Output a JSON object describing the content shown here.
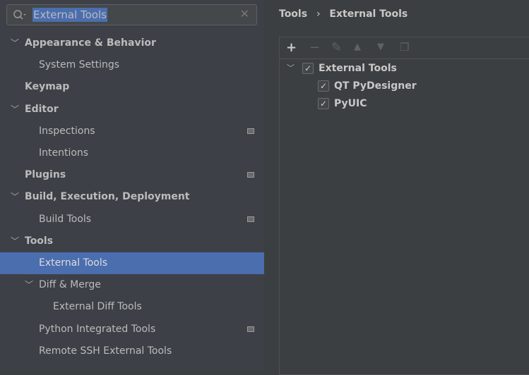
{
  "search": {
    "value": "External Tools",
    "icon": "search-icon"
  },
  "sidebar": {
    "items": [
      {
        "label": "Appearance & Behavior",
        "level": 0,
        "bold": true,
        "expanded": true
      },
      {
        "label": "System Settings",
        "level": 1
      },
      {
        "label": "Keymap",
        "level": 0,
        "bold": true
      },
      {
        "label": "Editor",
        "level": 0,
        "bold": true,
        "expanded": true
      },
      {
        "label": "Inspections",
        "level": 1,
        "project": true
      },
      {
        "label": "Intentions",
        "level": 1
      },
      {
        "label": "Plugins",
        "level": 0,
        "bold": true,
        "project": true
      },
      {
        "label": "Build, Execution, Deployment",
        "level": 0,
        "bold": true,
        "expanded": true
      },
      {
        "label": "Build Tools",
        "level": 1,
        "project": true
      },
      {
        "label": "Tools",
        "level": 0,
        "bold": true,
        "expanded": true
      },
      {
        "label": "External Tools",
        "level": 1,
        "selected": true
      },
      {
        "label": "Diff & Merge",
        "level": 1,
        "expanded": true
      },
      {
        "label": "External Diff Tools",
        "level": 2
      },
      {
        "label": "Python Integrated Tools",
        "level": 1,
        "project": true
      },
      {
        "label": "Remote SSH External Tools",
        "level": 1
      }
    ]
  },
  "breadcrumb": {
    "parent": "Tools",
    "separator": "›",
    "current": "External Tools"
  },
  "toolbar": [
    "add-icon",
    "remove-icon",
    "edit-icon",
    "move-up-icon",
    "move-down-icon",
    "copy-icon"
  ],
  "tree": {
    "group": {
      "label": "External Tools",
      "checked": true
    },
    "children": [
      {
        "label": "QT PyDesigner",
        "checked": true
      },
      {
        "label": "PyUIC",
        "checked": true
      }
    ]
  },
  "colors": {
    "selection": "#4b6eaf",
    "sidebar": "#3d4046",
    "panel": "#3c3f41"
  }
}
